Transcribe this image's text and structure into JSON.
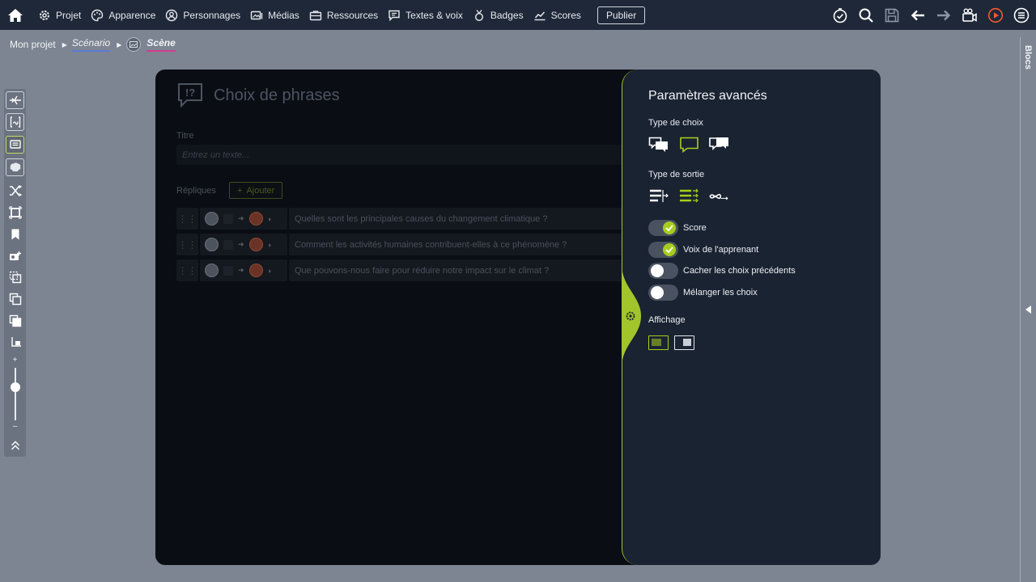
{
  "nav": {
    "items": [
      {
        "label": "Projet",
        "icon": "gear-icon"
      },
      {
        "label": "Apparence",
        "icon": "palette-icon"
      },
      {
        "label": "Personnages",
        "icon": "person-icon"
      },
      {
        "label": "Médias",
        "icon": "media-icon"
      },
      {
        "label": "Ressources",
        "icon": "briefcase-icon"
      },
      {
        "label": "Textes & voix",
        "icon": "speech-icon"
      },
      {
        "label": "Badges",
        "icon": "medal-icon"
      },
      {
        "label": "Scores",
        "icon": "chart-icon"
      }
    ],
    "publish_label": "Publier"
  },
  "breadcrumb": {
    "project": "Mon projet",
    "scenario": "Scénario",
    "scene": "Scène"
  },
  "blocs_label": "Blocs",
  "modal": {
    "title": "Choix de phrases",
    "title_label": "Titre",
    "title_placeholder": "Entrez un texte...",
    "replies_label": "Répliques",
    "add_label": "Ajouter",
    "replies": [
      "Quelles sont les principales causes du changement climatique ?",
      "Comment les activités humaines contribuent-elles à ce phénomène ?",
      "Que pouvons-nous faire pour réduire notre impact sur le climat ?"
    ]
  },
  "settings": {
    "title": "Paramètres avancés",
    "choice_type_label": "Type de choix",
    "output_type_label": "Type de sortie",
    "toggles": [
      {
        "label": "Score",
        "on": true
      },
      {
        "label": "Voix de l'apprenant",
        "on": true
      },
      {
        "label": "Cacher les choix précédents",
        "on": false
      },
      {
        "label": "Mélanger les choix",
        "on": false
      }
    ],
    "display_label": "Affichage"
  },
  "colors": {
    "accent": "#a9cd1e",
    "topbar": "#1f2838",
    "panel": "#1a2332",
    "modal": "#0a0d13",
    "background": "#7d8592"
  }
}
